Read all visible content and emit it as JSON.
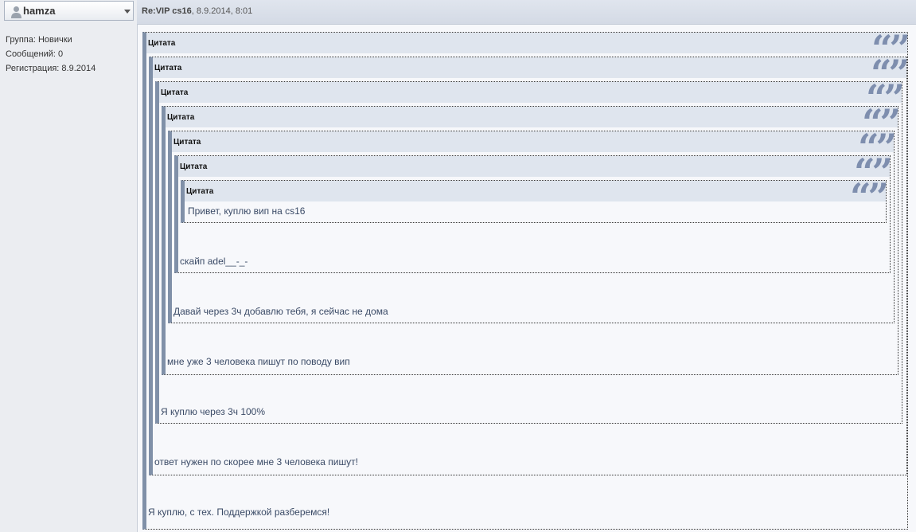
{
  "user": {
    "name": "hamza",
    "group": "Группа: Новички",
    "messages": "Сообщений: 0",
    "registration": "Регистрация: 8.9.2014"
  },
  "post": {
    "title": "Re:VIP cs16",
    "meta": ", 8.9.2014, 8:01"
  },
  "quotes": {
    "label": "Цитата",
    "icon": "“”",
    "texts": [
      "Привет, куплю вип на cs16",
      "скайп adel__-_-",
      "Давай через 3ч добавлю тебя, я сейчас не дома",
      "мне уже 3 человека пишут по поводу вип",
      "Я куплю через 3ч 100%",
      "ответ нужен по скорее мне 3 человека пишут!"
    ]
  },
  "body_text": "Я куплю, с тех. Поддержкой разберемся!"
}
